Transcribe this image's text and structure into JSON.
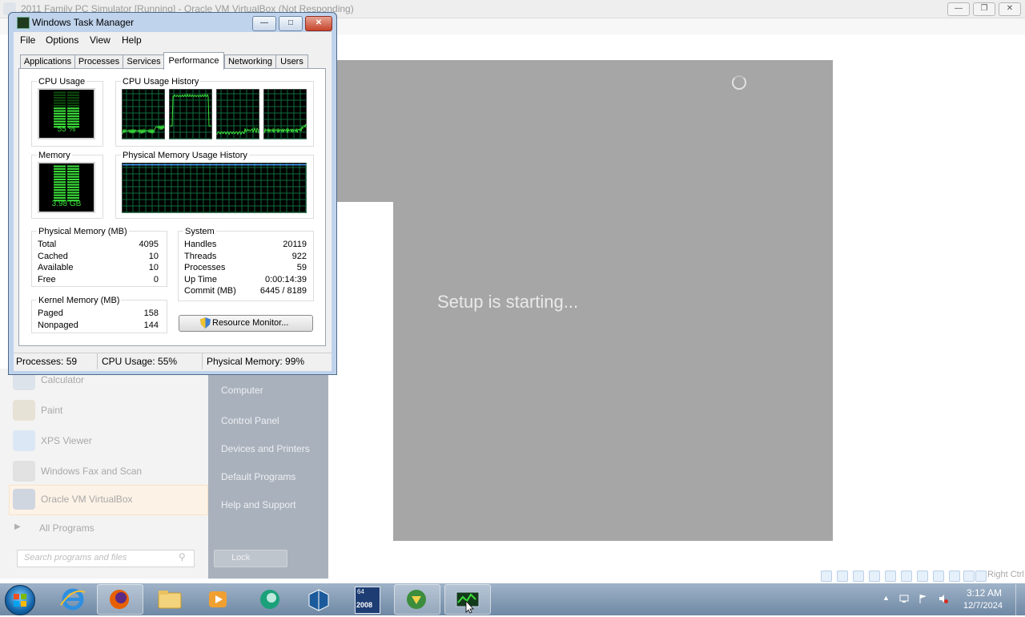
{
  "vbox": {
    "title": "2011 Family PC Simulator [Running] - Oracle VM VirtualBox (Not Responding)",
    "controls": {
      "minimize": "—",
      "restore": "❐",
      "close": "✕"
    },
    "setup_text": "Setup is starting...",
    "host_key": "Right Ctrl"
  },
  "start_menu": {
    "items": [
      {
        "label": "Calculator",
        "icon": "calculator-icon"
      },
      {
        "label": "Paint",
        "icon": "paint-icon"
      },
      {
        "label": "XPS Viewer",
        "icon": "xps-viewer-icon"
      },
      {
        "label": "Windows Fax and Scan",
        "icon": "fax-scan-icon"
      },
      {
        "label": "Oracle VM VirtualBox",
        "icon": "virtualbox-icon"
      }
    ],
    "all_programs": "All Programs",
    "search_placeholder": "Search programs and files",
    "right_items": [
      "Computer",
      "Control Panel",
      "Devices and Printers",
      "Default Programs",
      "Help and Support"
    ],
    "shutdown": "Lock"
  },
  "task_manager": {
    "title": "Windows Task Manager",
    "menu": [
      "File",
      "Options",
      "View",
      "Help"
    ],
    "tabs": [
      "Applications",
      "Processes",
      "Services",
      "Performance",
      "Networking",
      "Users"
    ],
    "active_tab": "Performance",
    "cpu_usage_label": "CPU Usage",
    "cpu_usage_value": "55 %",
    "cpu_usage_fraction": 0.55,
    "cpu_history_label": "CPU Usage History",
    "memory_label": "Memory",
    "memory_value": "3.98 GB",
    "memory_fraction": 0.99,
    "mem_history_label": "Physical Memory Usage History",
    "physical_memory": {
      "title": "Physical Memory (MB)",
      "rows": [
        {
          "label": "Total",
          "value": "4095"
        },
        {
          "label": "Cached",
          "value": "10"
        },
        {
          "label": "Available",
          "value": "10"
        },
        {
          "label": "Free",
          "value": "0"
        }
      ]
    },
    "kernel_memory": {
      "title": "Kernel Memory (MB)",
      "rows": [
        {
          "label": "Paged",
          "value": "158"
        },
        {
          "label": "Nonpaged",
          "value": "144"
        }
      ]
    },
    "system": {
      "title": "System",
      "rows": [
        {
          "label": "Handles",
          "value": "20119"
        },
        {
          "label": "Threads",
          "value": "922"
        },
        {
          "label": "Processes",
          "value": "59"
        },
        {
          "label": "Up Time",
          "value": "0:00:14:39"
        },
        {
          "label": "Commit (MB)",
          "value": "6445 / 8189"
        }
      ]
    },
    "resource_monitor_button": "Resource Monitor...",
    "status": {
      "processes": "Processes: 59",
      "cpu": "CPU Usage: 55%",
      "memory": "Physical Memory: 99%"
    },
    "colors": {
      "graph_green": "#3adf3a",
      "grid": "#0f6b3c",
      "memory_line": "#4aa3ff"
    }
  },
  "taskbar": {
    "time": "3:12 AM",
    "date": "12/7/2024",
    "badge_64": "64",
    "badge_2008": "2008",
    "buttons": [
      "internet-explorer-icon",
      "firefox-icon",
      "explorer-icon",
      "media-player-icon",
      "app-icon",
      "virtualbox-icon",
      "64bit-2008-icon",
      "download-manager-icon",
      "task-manager-icon"
    ]
  }
}
